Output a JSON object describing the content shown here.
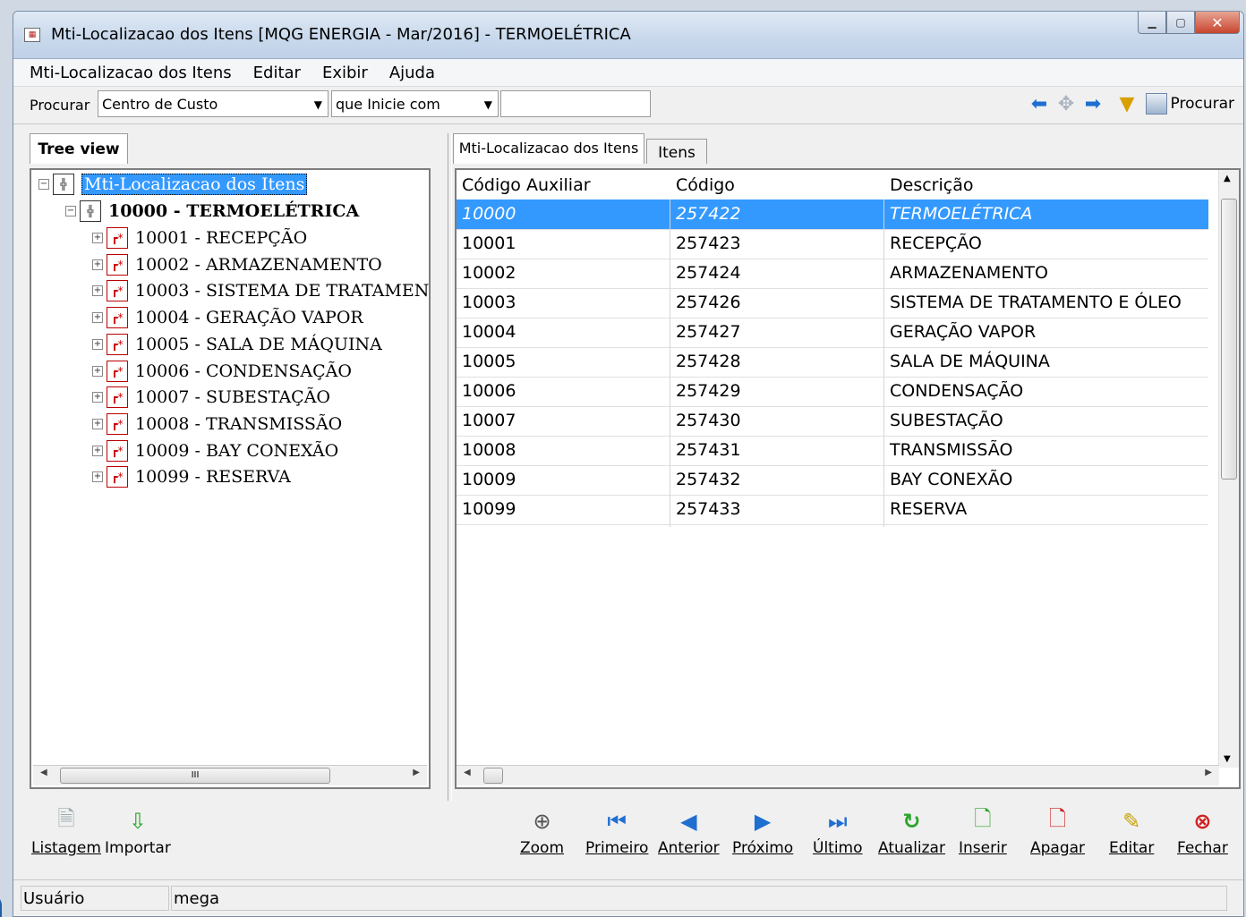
{
  "window": {
    "title": "Mti-Localizacao dos Itens [MQG ENERGIA - Mar/2016]  - TERMOELÉTRICA",
    "icon": "app-icon",
    "controls": [
      "minimize-icon",
      "maximize-icon",
      "close-icon"
    ]
  },
  "menu": [
    "Mti-Localizacao dos Itens",
    "Editar",
    "Exibir",
    "Ajuda"
  ],
  "search": {
    "label": "Procurar",
    "field": "Centro de Custo",
    "operator": "que Inicie com",
    "value": "",
    "button": "Procurar",
    "nav_icons": [
      "arrow-left-icon",
      "move-icon",
      "arrow-right-icon",
      "filter-icon"
    ]
  },
  "tree": {
    "tab": "Tree view",
    "root": "Mti-Localizacao dos Itens",
    "parent": "10000 - TERMOELÉTRICA",
    "children": [
      "10001 - RECEPÇÃO",
      "10002 - ARMAZENAMENTO",
      "10003 - SISTEMA DE TRATAMEN",
      "10004 - GERAÇÃO VAPOR",
      "10005 - SALA DE MÁQUINA",
      "10006 - CONDENSAÇÃO",
      "10007 - SUBESTAÇÃO",
      "10008 - TRANSMISSÃO",
      "10009 - BAY CONEXÃO",
      "10099 - RESERVA"
    ],
    "scroll_thumb": "III"
  },
  "tabs": [
    "Mti-Localizacao dos Itens",
    "Itens"
  ],
  "grid": {
    "columns": [
      "Código Auxiliar",
      "Código",
      "Descrição"
    ],
    "rows": [
      [
        "10000",
        "257422",
        "TERMOELÉTRICA"
      ],
      [
        "10001",
        "257423",
        "RECEPÇÃO"
      ],
      [
        "10002",
        "257424",
        "ARMAZENAMENTO"
      ],
      [
        "10003",
        "257426",
        "SISTEMA DE TRATAMENTO E ÓLEO"
      ],
      [
        "10004",
        "257427",
        "GERAÇÃO VAPOR"
      ],
      [
        "10005",
        "257428",
        "SALA DE MÁQUINA"
      ],
      [
        "10006",
        "257429",
        "CONDENSAÇÃO"
      ],
      [
        "10007",
        "257430",
        "SUBESTAÇÃO"
      ],
      [
        "10008",
        "257431",
        "TRANSMISSÃO"
      ],
      [
        "10009",
        "257432",
        "BAY CONEXÃO"
      ],
      [
        "10099",
        "257433",
        "RESERVA"
      ]
    ],
    "selected_row": 0
  },
  "toolbar_left": [
    {
      "label": "Listagem",
      "icon": "document-icon"
    },
    {
      "label": "Importar",
      "icon": "import-icon"
    }
  ],
  "toolbar_right": [
    {
      "label": "Zoom",
      "icon": "zoom-icon"
    },
    {
      "label": "Primeiro",
      "icon": "first-icon"
    },
    {
      "label": "Anterior",
      "icon": "previous-icon"
    },
    {
      "label": "Próximo",
      "icon": "next-icon"
    },
    {
      "label": "Último",
      "icon": "last-icon"
    },
    {
      "label": "Atualizar",
      "icon": "refresh-icon"
    },
    {
      "label": "Inserir",
      "icon": "insert-icon"
    },
    {
      "label": "Apagar",
      "icon": "delete-icon"
    },
    {
      "label": "Editar",
      "icon": "edit-icon"
    },
    {
      "label": "Fechar",
      "icon": "close-icon"
    }
  ],
  "status": {
    "label": "Usuário",
    "value": "mega"
  },
  "colors": {
    "selection": "#3399ff",
    "nav_arrows": "#1f6fd1",
    "refresh": "#2aa52a",
    "close": "#d02020"
  }
}
